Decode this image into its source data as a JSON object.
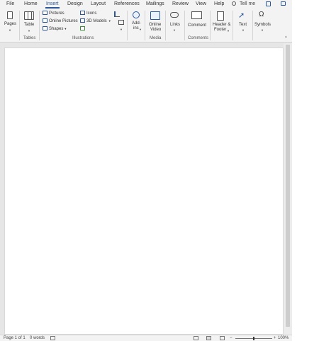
{
  "tabs": [
    "File",
    "Home",
    "Insert",
    "Design",
    "Layout",
    "References",
    "Mailings",
    "Review",
    "View",
    "Help"
  ],
  "active_tab": "Insert",
  "tell_me": "Tell me",
  "ribbon": {
    "pages": {
      "label": "Pages",
      "icon": "page-icon"
    },
    "tables": {
      "button": "Table",
      "group": "Tables",
      "icon": "table-icon"
    },
    "illustrations": {
      "group": "Illustrations",
      "pictures": "Pictures",
      "online_pictures": "Online Pictures",
      "shapes": "Shapes",
      "icons": "Icons",
      "models_3d": "3D Models"
    },
    "addins": {
      "label_line1": "Add-",
      "label_line2": "ins"
    },
    "media": {
      "label_line1": "Online",
      "label_line2": "Video",
      "group": "Media"
    },
    "links": {
      "label": "Links"
    },
    "comments": {
      "button": "Comment",
      "group": "Comments"
    },
    "header_footer": {
      "label_line1": "Header &",
      "label_line2": "Footer"
    },
    "text": {
      "label": "Text"
    },
    "symbols": {
      "label": "Symbols"
    }
  },
  "status": {
    "page": "Page 1 of 1",
    "words": "0 words",
    "zoom": "100%"
  },
  "accent_color": "#2b579a"
}
